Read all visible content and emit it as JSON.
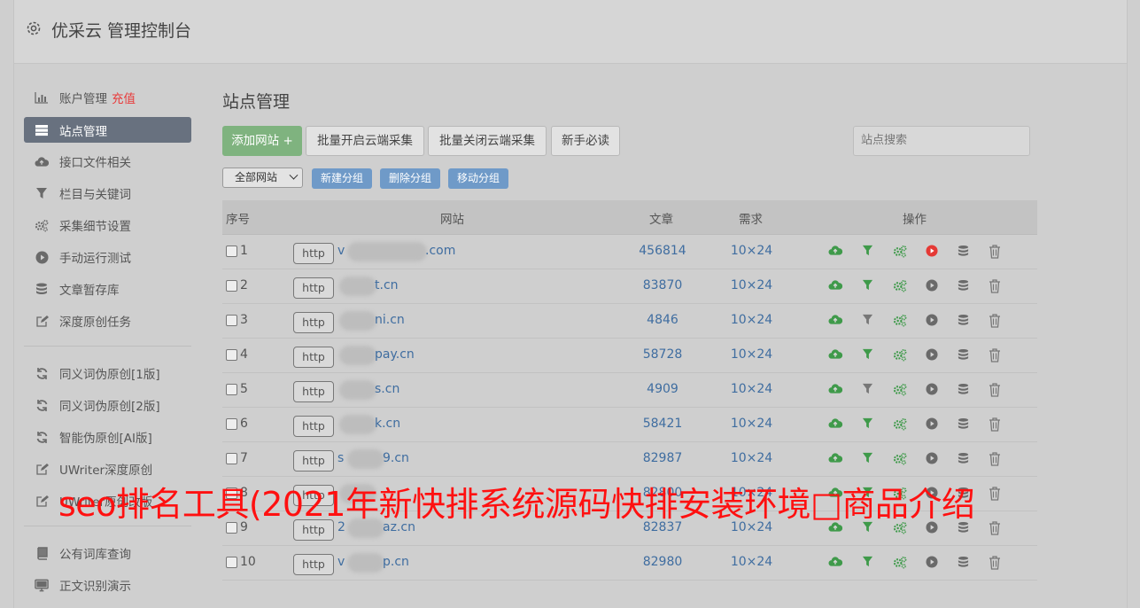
{
  "app": {
    "title": "优采云 管理控制台"
  },
  "sidebar": {
    "group1": [
      {
        "label": "账户管理",
        "icon": "bar-chart-icon",
        "extra": "充值"
      },
      {
        "label": "站点管理",
        "icon": "server-icon",
        "active": true
      },
      {
        "label": "接口文件相关",
        "icon": "cloud-upload-icon"
      },
      {
        "label": "栏目与关键词",
        "icon": "filter-icon"
      },
      {
        "label": "采集细节设置",
        "icon": "gears-icon"
      },
      {
        "label": "手动运行测试",
        "icon": "play-circle-icon"
      },
      {
        "label": "文章暂存库",
        "icon": "database-icon"
      },
      {
        "label": "深度原创任务",
        "icon": "edit-icon"
      }
    ],
    "group2": [
      {
        "label": "同义词伪原创[1版]",
        "icon": "refresh-icon"
      },
      {
        "label": "同义词伪原创[2版]",
        "icon": "refresh-icon"
      },
      {
        "label": "智能伪原创[AI版]",
        "icon": "refresh-icon"
      },
      {
        "label": "UWriter深度原创",
        "icon": "edit-icon"
      },
      {
        "label": "UWriter原创改版",
        "icon": "edit-icon"
      }
    ],
    "group3": [
      {
        "label": "公有词库查询",
        "icon": "book-icon"
      },
      {
        "label": "正文识别演示",
        "icon": "monitor-icon"
      }
    ]
  },
  "main": {
    "title": "站点管理",
    "buttons": {
      "add": "添加网站 +",
      "batch_on": "批量开启云端采集",
      "batch_off": "批量关闭云端采集",
      "guide": "新手必读"
    },
    "search_placeholder": "站点搜索",
    "group_select": "全部网站",
    "group_buttons": {
      "new": "新建分组",
      "delete": "删除分组",
      "move": "移动分组"
    },
    "table": {
      "headers": {
        "index": "序号",
        "site": "网站",
        "articles": "文章",
        "need": "需求",
        "ops": "操作"
      },
      "rows": [
        {
          "index": "1",
          "prefix": "http",
          "site": "v .com",
          "site_visible_start": "v",
          "site_visible_end": ".com",
          "articles": "456814",
          "need": "10×24",
          "running": true
        },
        {
          "index": "2",
          "prefix": "http",
          "site_visible_start": "",
          "site_visible_end": "t.cn",
          "articles": "83870",
          "need": "10×24",
          "running": false
        },
        {
          "index": "3",
          "prefix": "http",
          "site_visible_start": "",
          "site_visible_end": "ni.cn",
          "articles": "4846",
          "need": "10×24",
          "running": false
        },
        {
          "index": "4",
          "prefix": "http",
          "site_visible_start": "",
          "site_visible_end": "pay.cn",
          "articles": "58728",
          "need": "10×24",
          "running": false
        },
        {
          "index": "5",
          "prefix": "http",
          "site_visible_start": "",
          "site_visible_end": "s.cn",
          "articles": "4909",
          "need": "10×24",
          "running": false
        },
        {
          "index": "6",
          "prefix": "http",
          "site_visible_start": "",
          "site_visible_end": "k.cn",
          "articles": "58421",
          "need": "10×24",
          "running": false
        },
        {
          "index": "7",
          "prefix": "http",
          "site_visible_start": "s",
          "site_visible_end": "9.cn",
          "articles": "82987",
          "need": "10×24",
          "running": false
        },
        {
          "index": "8",
          "prefix": "http",
          "site_visible_start": "",
          "site_visible_end": "",
          "articles": "82800",
          "need": "10×24",
          "running": false
        },
        {
          "index": "9",
          "prefix": "http",
          "site_visible_start": "2",
          "site_visible_end": "az.cn",
          "articles": "82837",
          "need": "10×24",
          "running": false
        },
        {
          "index": "10",
          "prefix": "http",
          "site_visible_start": "v",
          "site_visible_end": "p.cn",
          "articles": "82980",
          "need": "10×24",
          "running": false
        }
      ]
    }
  },
  "overlay_text": "seo排名工具(2021年新快排系统源码快排安装环境□商品介绍",
  "colors": {
    "accent_green": "#5aa55a",
    "link_blue": "#3f6da0",
    "overlay_red": "#ff1010",
    "running_red": "#e53935"
  }
}
